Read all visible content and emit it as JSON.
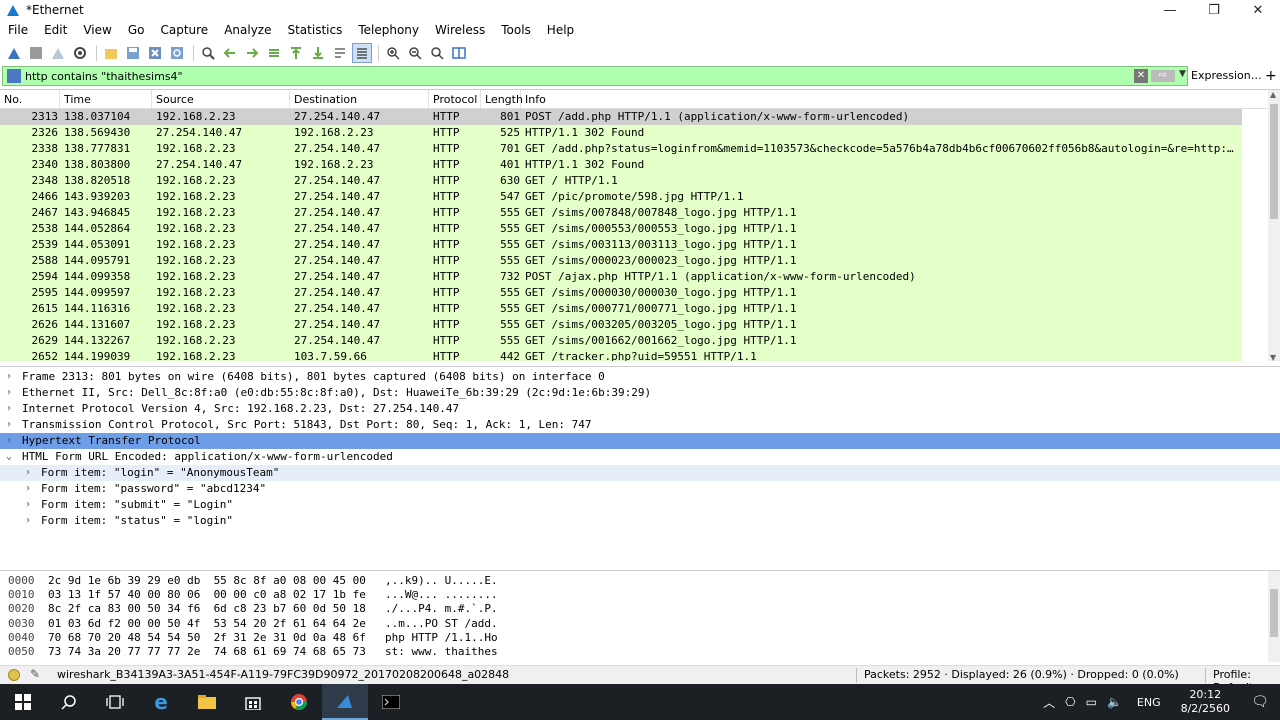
{
  "window": {
    "title": "*Ethernet",
    "minimize": "—",
    "maximize": "❐",
    "close": "✕"
  },
  "menu": [
    "File",
    "Edit",
    "View",
    "Go",
    "Capture",
    "Analyze",
    "Statistics",
    "Telephony",
    "Wireless",
    "Tools",
    "Help"
  ],
  "filter": {
    "value": "http contains \"thaithesims4\"",
    "clear": "✕",
    "apply": "⇨",
    "dropdown": "▼",
    "expression_label": "Expression…",
    "plus": "+"
  },
  "packet_list": {
    "columns": [
      "No.",
      "Time",
      "Source",
      "Destination",
      "Protocol",
      "Length",
      "Info"
    ],
    "rows": [
      {
        "no": "2313",
        "time": "138.037104",
        "src": "192.168.2.23",
        "dst": "27.254.140.47",
        "proto": "HTTP",
        "len": "801",
        "info": "POST /add.php HTTP/1.1  (application/x-www-form-urlencoded)",
        "selected": true
      },
      {
        "no": "2326",
        "time": "138.569430",
        "src": "27.254.140.47",
        "dst": "192.168.2.23",
        "proto": "HTTP",
        "len": "525",
        "info": "HTTP/1.1 302 Found"
      },
      {
        "no": "2338",
        "time": "138.777831",
        "src": "192.168.2.23",
        "dst": "27.254.140.47",
        "proto": "HTTP",
        "len": "701",
        "info": "GET /add.php?status=loginfrom&memid=1103573&checkcode=5a576b4a78db4b6cf00670602ff056b8&autologin=&re=http:/…"
      },
      {
        "no": "2340",
        "time": "138.803800",
        "src": "27.254.140.47",
        "dst": "192.168.2.23",
        "proto": "HTTP",
        "len": "401",
        "info": "HTTP/1.1 302 Found"
      },
      {
        "no": "2348",
        "time": "138.820518",
        "src": "192.168.2.23",
        "dst": "27.254.140.47",
        "proto": "HTTP",
        "len": "630",
        "info": "GET / HTTP/1.1"
      },
      {
        "no": "2466",
        "time": "143.939203",
        "src": "192.168.2.23",
        "dst": "27.254.140.47",
        "proto": "HTTP",
        "len": "547",
        "info": "GET /pic/promote/598.jpg HTTP/1.1"
      },
      {
        "no": "2467",
        "time": "143.946845",
        "src": "192.168.2.23",
        "dst": "27.254.140.47",
        "proto": "HTTP",
        "len": "555",
        "info": "GET /sims/007848/007848_logo.jpg HTTP/1.1"
      },
      {
        "no": "2538",
        "time": "144.052864",
        "src": "192.168.2.23",
        "dst": "27.254.140.47",
        "proto": "HTTP",
        "len": "555",
        "info": "GET /sims/000553/000553_logo.jpg HTTP/1.1"
      },
      {
        "no": "2539",
        "time": "144.053091",
        "src": "192.168.2.23",
        "dst": "27.254.140.47",
        "proto": "HTTP",
        "len": "555",
        "info": "GET /sims/003113/003113_logo.jpg HTTP/1.1"
      },
      {
        "no": "2588",
        "time": "144.095791",
        "src": "192.168.2.23",
        "dst": "27.254.140.47",
        "proto": "HTTP",
        "len": "555",
        "info": "GET /sims/000023/000023_logo.jpg HTTP/1.1"
      },
      {
        "no": "2594",
        "time": "144.099358",
        "src": "192.168.2.23",
        "dst": "27.254.140.47",
        "proto": "HTTP",
        "len": "732",
        "info": "POST /ajax.php HTTP/1.1  (application/x-www-form-urlencoded)"
      },
      {
        "no": "2595",
        "time": "144.099597",
        "src": "192.168.2.23",
        "dst": "27.254.140.47",
        "proto": "HTTP",
        "len": "555",
        "info": "GET /sims/000030/000030_logo.jpg HTTP/1.1"
      },
      {
        "no": "2615",
        "time": "144.116316",
        "src": "192.168.2.23",
        "dst": "27.254.140.47",
        "proto": "HTTP",
        "len": "555",
        "info": "GET /sims/000771/000771_logo.jpg HTTP/1.1"
      },
      {
        "no": "2626",
        "time": "144.131607",
        "src": "192.168.2.23",
        "dst": "27.254.140.47",
        "proto": "HTTP",
        "len": "555",
        "info": "GET /sims/003205/003205_logo.jpg HTTP/1.1"
      },
      {
        "no": "2629",
        "time": "144.132267",
        "src": "192.168.2.23",
        "dst": "27.254.140.47",
        "proto": "HTTP",
        "len": "555",
        "info": "GET /sims/001662/001662_logo.jpg HTTP/1.1"
      },
      {
        "no": "2652",
        "time": "144.199039",
        "src": "192.168.2.23",
        "dst": "103.7.59.66",
        "proto": "HTTP",
        "len": "442",
        "info": "GET /tracker.php?uid=59551 HTTP/1.1"
      }
    ]
  },
  "details": [
    {
      "text": "Frame 2313: 801 bytes on wire (6408 bits), 801 bytes captured (6408 bits) on interface 0",
      "arrow": "›",
      "level": 0
    },
    {
      "text": "Ethernet II, Src: Dell_8c:8f:a0 (e0:db:55:8c:8f:a0), Dst: HuaweiTe_6b:39:29 (2c:9d:1e:6b:39:29)",
      "arrow": "›",
      "level": 0
    },
    {
      "text": "Internet Protocol Version 4, Src: 192.168.2.23, Dst: 27.254.140.47",
      "arrow": "›",
      "level": 0
    },
    {
      "text": "Transmission Control Protocol, Src Port: 51843, Dst Port: 80, Seq: 1, Ack: 1, Len: 747",
      "arrow": "›",
      "level": 0
    },
    {
      "text": "Hypertext Transfer Protocol",
      "arrow": "›",
      "level": 0,
      "state": "sel"
    },
    {
      "text": "HTML Form URL Encoded: application/x-www-form-urlencoded",
      "arrow": "⌄",
      "level": 0
    },
    {
      "text": "Form item: \"login\" = \"AnonymousTeam\"",
      "arrow": "›",
      "level": 1,
      "state": "hover"
    },
    {
      "text": "Form item: \"password\" = \"abcd1234\"",
      "arrow": "›",
      "level": 1
    },
    {
      "text": "Form item: \"submit\" = \"Login\"",
      "arrow": "›",
      "level": 1
    },
    {
      "text": "Form item: \"status\" = \"login\"",
      "arrow": "›",
      "level": 1
    }
  ],
  "bytes": [
    {
      "off": "0000",
      "hex": "2c 9d 1e 6b 39 29 e0 db  55 8c 8f a0 08 00 45 00",
      "ascii": ",..k9).. U.....E."
    },
    {
      "off": "0010",
      "hex": "03 13 1f 57 40 00 80 06  00 00 c0 a8 02 17 1b fe",
      "ascii": "...W@... ........"
    },
    {
      "off": "0020",
      "hex": "8c 2f ca 83 00 50 34 f6  6d c8 23 b7 60 0d 50 18",
      "ascii": "./...P4. m.#.`.P."
    },
    {
      "off": "0030",
      "hex": "01 03 6d f2 00 00 50 4f  53 54 20 2f 61 64 64 2e",
      "ascii": "..m...PO ST /add."
    },
    {
      "off": "0040",
      "hex": "70 68 70 20 48 54 54 50  2f 31 2e 31 0d 0a 48 6f",
      "ascii": "php HTTP /1.1..Ho"
    },
    {
      "off": "0050",
      "hex": "73 74 3a 20 77 77 77 2e  74 68 61 69 74 68 65 73",
      "ascii": "st: www. thaithes"
    }
  ],
  "status": {
    "file": "wireshark_B34139A3-3A51-454F-A119-79FC39D90972_20170208200648_a02848",
    "packets": "Packets: 2952 · Displayed: 26 (0.9%) · Dropped: 0 (0.0%)",
    "profile": "Profile: Default"
  },
  "taskbar": {
    "lang": "ENG",
    "time": "20:12",
    "date": "8/2/2560"
  }
}
